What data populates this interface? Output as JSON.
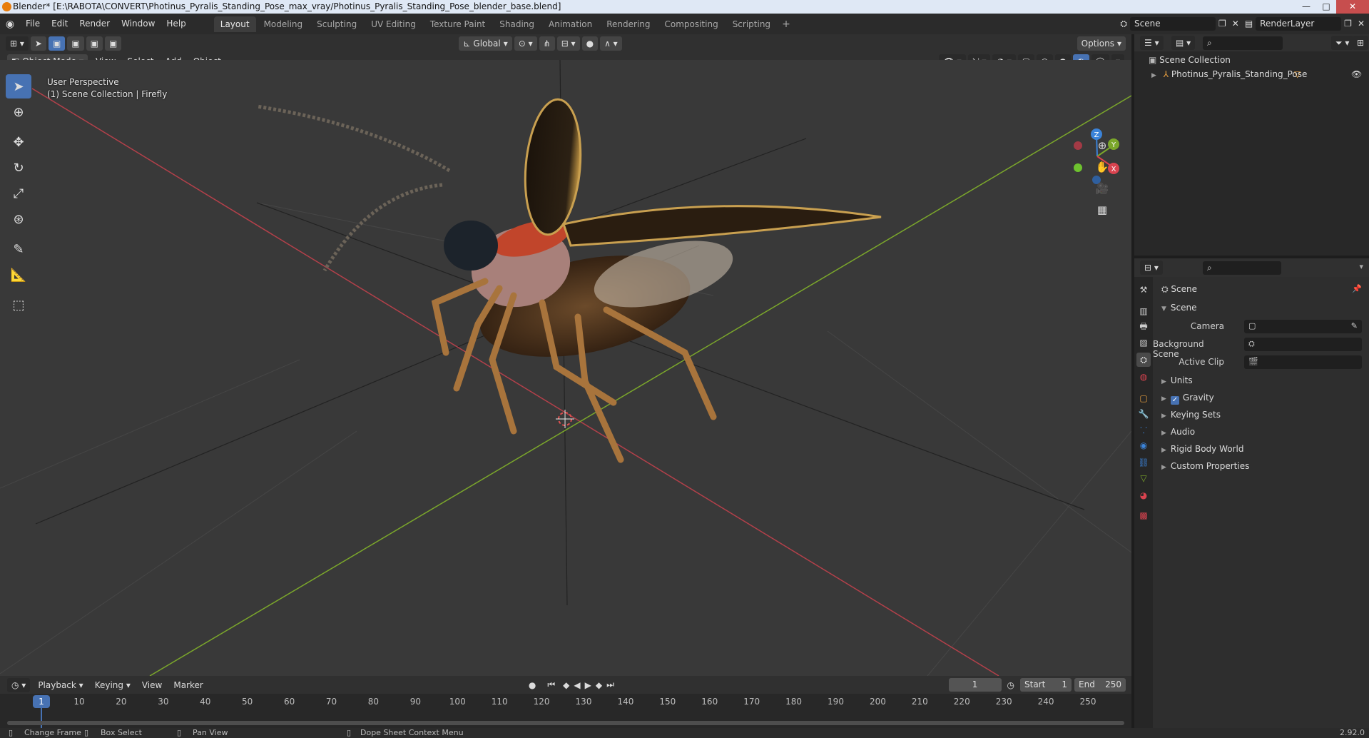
{
  "window": {
    "title": "Blender* [E:\\RABOTA\\CONVERT\\Photinus_Pyralis_Standing_Pose_max_vray/Photinus_Pyralis_Standing_Pose_blender_base.blend]"
  },
  "menu": [
    "File",
    "Edit",
    "Render",
    "Window",
    "Help"
  ],
  "workspaces": [
    "Layout",
    "Modeling",
    "Sculpting",
    "UV Editing",
    "Texture Paint",
    "Shading",
    "Animation",
    "Rendering",
    "Compositing",
    "Scripting"
  ],
  "top_right": {
    "scene": "Scene",
    "view_layer": "RenderLayer"
  },
  "viewport_header": {
    "transform_orientation": "Global",
    "options_label": "Options",
    "mode": "Object Mode",
    "menus": [
      "View",
      "Select",
      "Add",
      "Object"
    ]
  },
  "viewport": {
    "perspective": "User Perspective",
    "collection_info": "(1) Scene Collection | Firefly",
    "gizmo_axes": [
      "Z",
      "Y",
      "X"
    ]
  },
  "outliner": {
    "root": "Scene Collection",
    "items": [
      {
        "name": "Photinus_Pyralis_Standing_Pose"
      }
    ]
  },
  "properties": {
    "context_name": "Scene",
    "section": "Scene",
    "fields": [
      {
        "label": "Camera"
      },
      {
        "label": "Background Scene"
      },
      {
        "label": "Active Clip"
      }
    ],
    "panels": [
      {
        "label": "Units",
        "checkbox": false
      },
      {
        "label": "Gravity",
        "checkbox": true
      },
      {
        "label": "Keying Sets",
        "checkbox": false
      },
      {
        "label": "Audio",
        "checkbox": false
      },
      {
        "label": "Rigid Body World",
        "checkbox": false
      },
      {
        "label": "Custom Properties",
        "checkbox": false
      }
    ]
  },
  "timeline": {
    "menus": [
      "Playback",
      "Keying",
      "View",
      "Marker"
    ],
    "current_frame": "1",
    "start_label": "Start",
    "start": "1",
    "end_label": "End",
    "end": "250",
    "ticks": [
      "1",
      "10",
      "20",
      "30",
      "40",
      "50",
      "60",
      "70",
      "80",
      "90",
      "100",
      "110",
      "120",
      "130",
      "140",
      "150",
      "160",
      "170",
      "180",
      "190",
      "200",
      "210",
      "220",
      "230",
      "240",
      "250"
    ]
  },
  "statusbar": {
    "items": [
      "Change Frame",
      "Box Select",
      "Pan View",
      "Dope Sheet Context Menu"
    ],
    "version": "2.92.0"
  },
  "colors": {
    "accent": "#4772b3",
    "x_axis": "#d9434f",
    "y_axis": "#7ba72b",
    "z_axis": "#3b83d9",
    "bg_viewport": "#393939"
  }
}
